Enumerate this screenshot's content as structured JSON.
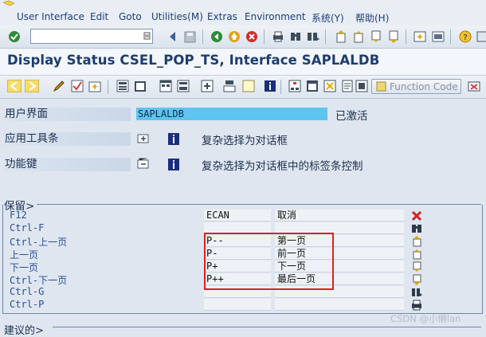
{
  "menu": {
    "items": [
      "User Interface",
      "Edit",
      "Goto",
      "Utilities(M)",
      "Extras",
      "Environment",
      "系统(Y)",
      "帮助(H)"
    ]
  },
  "toolbar": {
    "command_value": ""
  },
  "title": "Display Status CSEL_POP_TS, Interface SAPLALDB",
  "app_toolbar": {
    "function_code_label": "Function Code"
  },
  "header": {
    "interface_label": "用户界面",
    "interface_value": "SAPLALDB",
    "interface_status": "已激活",
    "app_toolbar_label": "应用工具条",
    "app_toolbar_text": "复杂选择为对话框",
    "function_keys_label": "功能键",
    "function_keys_text": "复杂选择为对话框中的标签条控制"
  },
  "reserved": {
    "title": "保留",
    "rows": [
      {
        "key": "F12",
        "code": "ECAN",
        "text": "取消",
        "icon": "cancel-icon"
      },
      {
        "key": "Ctrl-F",
        "code": "",
        "text": "",
        "icon": "find-icon"
      },
      {
        "key": "Ctrl-上一页",
        "code": "P--",
        "text": "第一页",
        "icon": "first-page-icon"
      },
      {
        "key": "上一页",
        "code": "P-",
        "text": "前一页",
        "icon": "previous-page-icon"
      },
      {
        "key": "下一页",
        "code": "P+",
        "text": "下一页",
        "icon": "next-page-icon"
      },
      {
        "key": "Ctrl-下一页",
        "code": "P++",
        "text": "最后一页",
        "icon": "last-page-icon"
      },
      {
        "key": "Ctrl-G",
        "code": "",
        "text": "",
        "icon": "find-next-icon"
      },
      {
        "key": "Ctrl-P",
        "code": "",
        "text": "",
        "icon": "print-icon"
      }
    ]
  },
  "bottom_section_label": "建议的",
  "watermark": "CSDN @小懒lan",
  "colors": {
    "highlight": "#5ec6ee",
    "annotation_box": "#e02020",
    "title_text": "#1d3d6f"
  }
}
